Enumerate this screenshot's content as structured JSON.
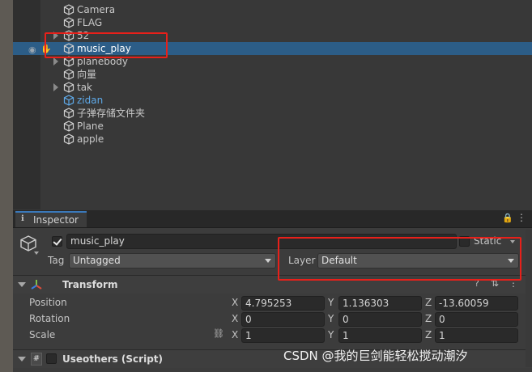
{
  "hierarchy": {
    "items": [
      {
        "label": "Camera",
        "foldout": false,
        "blue": false
      },
      {
        "label": "FLAG",
        "foldout": false,
        "blue": false
      },
      {
        "label": "52",
        "foldout": true,
        "blue": false
      },
      {
        "label": "music_play",
        "foldout": false,
        "blue": false,
        "selected": true
      },
      {
        "label": "planebody",
        "foldout": true,
        "blue": false
      },
      {
        "label": "向量",
        "foldout": false,
        "blue": false
      },
      {
        "label": "tak",
        "foldout": true,
        "blue": false
      },
      {
        "label": "zidan",
        "foldout": false,
        "blue": true
      },
      {
        "label": "子弹存储文件夹",
        "foldout": false,
        "blue": false
      },
      {
        "label": "Plane",
        "foldout": false,
        "blue": false
      },
      {
        "label": "apple",
        "foldout": false,
        "blue": false
      }
    ]
  },
  "inspector": {
    "tab_label": "Inspector",
    "object": {
      "active": true,
      "name": "music_play",
      "static_label": "Static",
      "tag_label": "Tag",
      "tag_value": "Untagged",
      "layer_label": "Layer",
      "layer_value": "Default"
    },
    "transform": {
      "title": "Transform",
      "position_label": "Position",
      "rotation_label": "Rotation",
      "scale_label": "Scale",
      "x": "X",
      "y": "Y",
      "z": "Z",
      "position": {
        "x": "4.795253",
        "y": "1.136303",
        "z": "-13.60059"
      },
      "rotation": {
        "x": "0",
        "y": "0",
        "z": "0"
      },
      "scale": {
        "x": "1",
        "y": "1",
        "z": "1"
      }
    },
    "script_component": {
      "title": "Useothers (Script)"
    }
  },
  "watermark": "CSDN @我的巨剑能轻松搅动潮汐",
  "colors": {
    "selection": "#2c5d87",
    "highlight_box": "#e8201a",
    "accent_tab": "#3a79bb"
  }
}
